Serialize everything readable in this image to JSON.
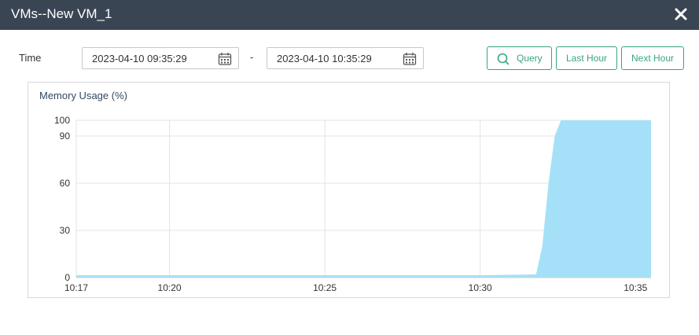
{
  "window": {
    "title": "VMs--New VM_1",
    "close_icon": "close-icon"
  },
  "filter": {
    "time_label": "Time",
    "start": "2023-04-10 09:35:29",
    "separator": "-",
    "end": "2023-04-10 10:35:29",
    "calendar_icon": "calendar-icon"
  },
  "buttons": {
    "query": "Query",
    "query_icon": "search-icon",
    "last_hour": "Last Hour",
    "next_hour": "Next Hour",
    "accent": "#3aa57c"
  },
  "panel": {
    "title": "Memory Usage (%)"
  },
  "chart_data": {
    "type": "area",
    "title": "Memory Usage (%)",
    "x_ticks": [
      "10:17",
      "10:20",
      "10:25",
      "10:30",
      "10:35"
    ],
    "x_tick_minutes": [
      17,
      20,
      25,
      30,
      35
    ],
    "y_ticks": [
      0,
      30,
      60,
      90,
      100
    ],
    "ylim": [
      0,
      100
    ],
    "xlim_minutes": [
      17,
      35.5
    ],
    "grid": true,
    "fill_color": "#a4e1f8",
    "series": [
      {
        "x_minutes": [
          17,
          20,
          25,
          30,
          31.8,
          32.0,
          32.2,
          32.4,
          32.6,
          35.5
        ],
        "values": [
          1.5,
          1.5,
          1.5,
          1.5,
          2,
          20,
          60,
          90,
          100,
          100
        ]
      }
    ]
  }
}
